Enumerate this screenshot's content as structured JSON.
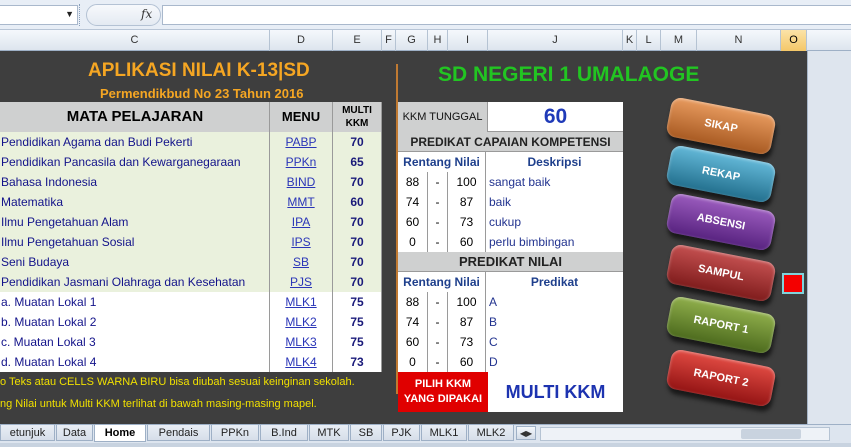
{
  "formula_bar": {
    "namebox_value": "",
    "fx_label": "fx",
    "formula_value": ""
  },
  "columns": [
    "C",
    "D",
    "E",
    "F",
    "G",
    "H",
    "I",
    "J",
    "K",
    "L",
    "M",
    "N",
    "O"
  ],
  "active_column": "O",
  "header": {
    "title": "APLIKASI NILAI K-13|SD",
    "subtitle": "Permendikbud No 23 Tahun 2016",
    "school": "SD NEGERI 1 UMALAOGE"
  },
  "subjects_table": {
    "col_subject": "MATA PELAJARAN",
    "col_menu": "MENU",
    "col_kkm": "MULTI KKM",
    "rows": [
      {
        "subject": "Pendidikan Agama dan Budi Pekerti",
        "menu": "PABP",
        "kkm": "70"
      },
      {
        "subject": "Pendidikan Pancasila dan Kewarganegaraan",
        "menu": "PPKn",
        "kkm": "65"
      },
      {
        "subject": "Bahasa Indonesia",
        "menu": "BIND",
        "kkm": "70"
      },
      {
        "subject": "Matematika",
        "menu": "MMT",
        "kkm": "60"
      },
      {
        "subject": "Ilmu Pengetahuan Alam",
        "menu": "IPA",
        "kkm": "70"
      },
      {
        "subject": "Ilmu Pengetahuan Sosial",
        "menu": "IPS",
        "kkm": "70"
      },
      {
        "subject": "Seni Budaya",
        "menu": "SB",
        "kkm": "70"
      },
      {
        "subject": "Pendidikan Jasmani Olahraga dan Kesehatan",
        "menu": "PJS",
        "kkm": "70"
      },
      {
        "subject": "a. Muatan Lokal 1",
        "menu": "MLK1",
        "kkm": "75"
      },
      {
        "subject": "b. Muatan Lokal 2",
        "menu": "MLK2",
        "kkm": "75"
      },
      {
        "subject": "c. Muatan Lokal 3",
        "menu": "MLK3",
        "kkm": "75"
      },
      {
        "subject": "d. Muatan Lokal 4",
        "menu": "MLK4",
        "kkm": "73"
      }
    ]
  },
  "kkm": {
    "label": "KKM TUNGGAL",
    "value": "60"
  },
  "predikat_kompetensi": {
    "title": "PREDIKAT CAPAIAN KOMPETENSI",
    "col_range": "Rentang Nilai",
    "col_desc": "Deskripsi",
    "rows": [
      {
        "min": "88",
        "sep": "-",
        "max": "100",
        "desc": "sangat baik"
      },
      {
        "min": "74",
        "sep": "-",
        "max": "87",
        "desc": "baik"
      },
      {
        "min": "60",
        "sep": "-",
        "max": "73",
        "desc": "cukup"
      },
      {
        "min": "0",
        "sep": "-",
        "max": "60",
        "desc": "perlu bimbingan"
      }
    ]
  },
  "predikat_nilai": {
    "title": "PREDIKAT NILAI",
    "col_range": "Rentang Nilai",
    "col_pred": "Predikat",
    "rows": [
      {
        "min": "88",
        "sep": "-",
        "max": "100",
        "pred": "A"
      },
      {
        "min": "74",
        "sep": "-",
        "max": "87",
        "pred": "B"
      },
      {
        "min": "60",
        "sep": "-",
        "max": "73",
        "pred": "C"
      },
      {
        "min": "0",
        "sep": "-",
        "max": "60",
        "pred": "D"
      }
    ]
  },
  "pilih": {
    "line1": "PILIH KKM",
    "line2": "YANG DIPAKAI",
    "value": "MULTI KKM"
  },
  "notes": {
    "note1": "o Teks atau CELLS WARNA BIRU bisa diubah sesuai keinginan sekolah.",
    "note2": "ng Nilai untuk Multi KKM terlihat di bawah masing-masing mapel."
  },
  "buttons": {
    "sikap": "SIKAP",
    "rekap": "REKAP",
    "absensi": "ABSENSI",
    "sampul": "SAMPUL",
    "raport1": "RAPORT 1",
    "raport2": "RAPORT 2"
  },
  "tabs": [
    "etunjuk",
    "Data",
    "Home",
    "Pendais",
    "PPKn",
    "B.Ind",
    "MTK",
    "SB",
    "PJK",
    "MLK1",
    "MLK2"
  ],
  "active_tab": "Home"
}
